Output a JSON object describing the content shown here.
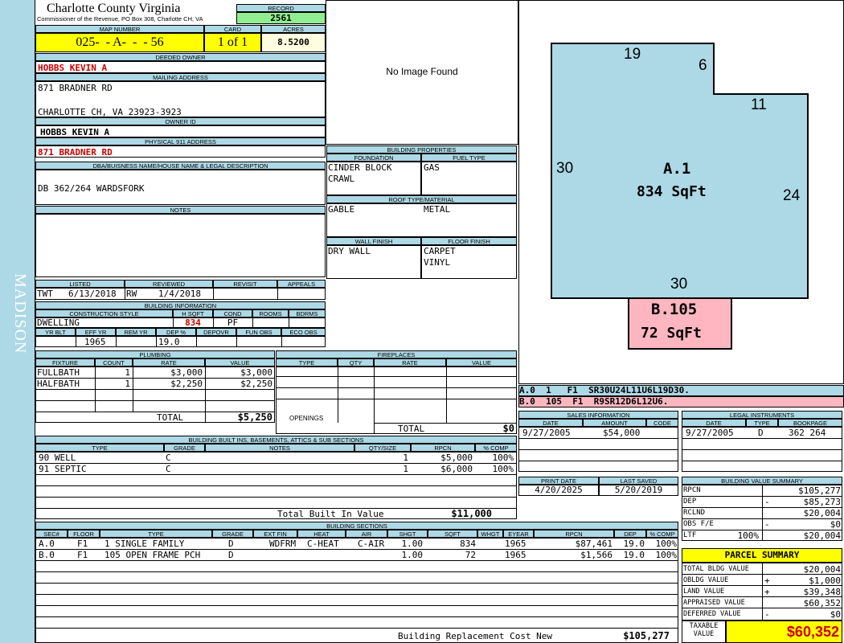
{
  "side_label": "MADISON",
  "header": {
    "county": "Charlotte County Virginia",
    "commissioner": "Commissioner of the Revenue, PO Box 308, Charlotte CH, VA",
    "record_label": "RECORD",
    "record": "2561"
  },
  "map": {
    "map_label": "MAP NUMBER",
    "map_number": "025-  - A-  -  - 56",
    "card_label": "CARD",
    "card": "1 of 1",
    "acres_label": "ACRES",
    "acres": "8.5200"
  },
  "owner": {
    "deeded_label": "DEEDED OWNER",
    "deeded": "HOBBS KEVIN A",
    "mailing_label": "MAILING ADDRESS",
    "mail1": "871 BRADNER RD",
    "mail2": "CHARLOTTE CH, VA 23923-3923",
    "owner_id_label": "OWNER ID",
    "owner_id": "HOBBS KEVIN A",
    "phys_label": "PHYSICAL 911 ADDRESS",
    "phys": "871 BRADNER RD"
  },
  "dba": {
    "label": "DBA/BUISNESS NAME/HOUSE NAME & LEGAL DESCRIPTION",
    "text": "DB 362/264 WARDSFORK"
  },
  "notes": {
    "label": "NOTES"
  },
  "image": {
    "text": "No Image Found"
  },
  "listed": {
    "listed_label": "LISTED",
    "listed_by": "TWT",
    "listed": "6/13/2018",
    "reviewed_label": "REVIEWED",
    "reviewed_by": "RW",
    "reviewed": "1/4/2018",
    "revisit_label": "REVISIT",
    "appeals_label": "APPEALS"
  },
  "bldg_info": {
    "label": "BUILDING INFORMATION",
    "cs_label": "CONSTRUCTION STYLE",
    "hsqft_label": "H SQFT",
    "cond_label": "COND",
    "rooms_label": "ROOMS",
    "bdrms_label": "BDRMS",
    "style": "DWELLING",
    "hsqft": "834",
    "cond": "PF",
    "yrblt_label": "YR BLT",
    "effyr_label": "EFF YR",
    "remyr_label": "REM YR",
    "dep_label": "DEP %",
    "depovr_label": "DEPOVR",
    "funobs_label": "FUN OBS",
    "ecoobs_label": "ECO OBS",
    "effyr": "1965",
    "dep": "19.0"
  },
  "bldg_props": {
    "label": "BUILDING PROPERTIES",
    "found_label": "FOUNDATION",
    "fuel_label": "FUEL TYPE",
    "found1": "CINDER BLOCK",
    "found2": "CRAWL",
    "fuel": "GAS",
    "roof_label": "ROOF TYPE/MATERIAL",
    "roof1": "GABLE",
    "roof2": "METAL",
    "wall_label": "WALL FINISH",
    "floor_label": "FLOOR FINISH",
    "wall": "DRY WALL",
    "floor1": "CARPET",
    "floor2": "VINYL"
  },
  "plumbing": {
    "label": "PLUMBING",
    "headers": [
      "FIXTURE",
      "COUNT",
      "RATE",
      "VALUE"
    ],
    "rows": [
      [
        "FULLBATH",
        "1",
        "$3,000",
        "$3,000"
      ],
      [
        "HALFBATH",
        "1",
        "$2,250",
        "$2,250"
      ]
    ],
    "total_label": "TOTAL",
    "total": "$5,250"
  },
  "fireplaces": {
    "label": "FIREPLACES",
    "headers": [
      "TYPE",
      "QTY",
      "RATE",
      "VALUE"
    ],
    "openings_label": "OPENINGS",
    "total_label": "TOTAL",
    "total": "$0"
  },
  "builtins": {
    "label": "BUILDING BUILT INS, BASEMENTS, ATTICS & SUB SECTIONS",
    "headers": [
      "TYPE",
      "GRADE",
      "NOTES",
      "QTY/SIZE",
      "RPCN",
      "% COMP"
    ],
    "rows": [
      [
        "90 WELL",
        "C",
        "",
        "1",
        "$5,000",
        "100%"
      ],
      [
        "91 SEPTIC",
        "C",
        "",
        "1",
        "$6,000",
        "100%"
      ]
    ],
    "total_label": "Total Built In Value",
    "total": "$11,000"
  },
  "sections": {
    "label": "BUILDING SECTIONS",
    "headers": [
      "SEC#",
      "FLOOR",
      "TYPE",
      "GRADE",
      "EXT FIN",
      "HEAT",
      "AIR",
      "SHGT",
      "SQFT",
      "WHGT",
      "EYEAR",
      "RPCN",
      "DEP",
      "% COMP"
    ],
    "rows": [
      [
        "A.0",
        "F1",
        "1 SINGLE FAMILY",
        "D",
        "WDFRM",
        "C-HEAT",
        "C-AIR",
        "1.00",
        "834",
        "",
        "1965",
        "$87,461",
        "19.0",
        "100%"
      ],
      [
        "B.0",
        "F1",
        "105 OPEN FRAME PCH",
        "D",
        "",
        "",
        "",
        "1.00",
        "72",
        "",
        "1965",
        "$1,566",
        "19.0",
        "100%"
      ]
    ],
    "total_label": "Building Replacement Cost New",
    "total": "$105,277"
  },
  "sketch": {
    "a_label": "A.1",
    "a_area": "834 SqFt",
    "b_label": "B.105",
    "b_area": "72 SqFt",
    "dims": [
      "19",
      "6",
      "11",
      "30",
      "24",
      "30"
    ],
    "a_color": "#add8e6",
    "b_color": "#ffb6c1",
    "line_a": "A.0  1   F1  SR30U24L11U6L19D30.",
    "line_b": "B.0  105  F1  R9SR12D6L12U6."
  },
  "sales": {
    "label": "SALES INFORMATION",
    "headers": [
      "DATE",
      "AMOUNT",
      "CODE"
    ],
    "rows": [
      [
        "9/27/2005",
        "$54,000",
        ""
      ]
    ]
  },
  "legal": {
    "label": "LEGAL INSTRUMENTS",
    "headers": [
      "DATE",
      "TYPE",
      "BOOKPAGE"
    ],
    "rows": [
      [
        "9/27/2005",
        "D",
        "362 264"
      ]
    ]
  },
  "dates": {
    "print_label": "PRINT DATE",
    "print": "4/20/2025",
    "saved_label": "LAST SAVED",
    "saved": "5/20/2019"
  },
  "value_summary": {
    "label": "BUILDING VALUE SUMMARY",
    "rows": [
      [
        "RPCN",
        "",
        "$105,277"
      ],
      [
        "DEP",
        "-",
        "$85,273"
      ],
      [
        "RCLND",
        "",
        "$20,004"
      ],
      [
        "OBS F/E",
        "-",
        "$0"
      ],
      [
        "LTF",
        "100%",
        "$20,004"
      ]
    ]
  },
  "parcel": {
    "label": "PARCEL SUMMARY",
    "rows": [
      [
        "TOTAL BLDG VALUE",
        "",
        "$20,004"
      ],
      [
        "OBLDG VALUE",
        "+",
        "$1,000"
      ],
      [
        "LAND VALUE",
        "+",
        "$39,348"
      ],
      [
        "APPRAISED VALUE",
        "",
        "$60,352"
      ],
      [
        "DEFERRED VALUE",
        "-",
        "$0"
      ]
    ],
    "taxable_label1": "TAXABLE",
    "taxable_label2": "VALUE",
    "taxable": "$60,352"
  }
}
